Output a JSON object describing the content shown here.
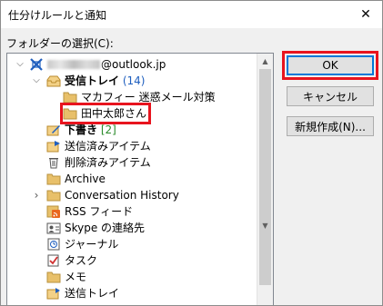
{
  "window": {
    "title": "仕分けルールと通知",
    "close_glyph": "✕"
  },
  "folder_label": "フォルダーの選択(C):",
  "tree": {
    "account": {
      "suffix": "@outlook.jp",
      "expanded": true
    },
    "items": [
      {
        "label": "受信トレイ",
        "count": "(14)",
        "bold": true,
        "expanded": true,
        "icon": "inbox-icon"
      },
      {
        "label": "マカフィー 迷惑メール対策",
        "icon": "folder-icon"
      },
      {
        "label": "田中太郎さん",
        "icon": "folder-icon",
        "highlighted": true
      },
      {
        "label": "下書き",
        "count": "[2]",
        "bold": true,
        "icon": "drafts-icon"
      },
      {
        "label": "送信済みアイテム",
        "icon": "sent-items-icon"
      },
      {
        "label": "削除済みアイテム",
        "icon": "trash-icon"
      },
      {
        "label": "Archive",
        "icon": "folder-icon"
      },
      {
        "label": "Conversation History",
        "icon": "folder-icon",
        "collapsed": true
      },
      {
        "label": "RSS フィード",
        "icon": "rss-icon"
      },
      {
        "label": "Skype の連絡先",
        "icon": "contacts-icon"
      },
      {
        "label": "ジャーナル",
        "icon": "journal-icon"
      },
      {
        "label": "タスク",
        "icon": "tasks-icon"
      },
      {
        "label": "メモ",
        "icon": "notes-icon"
      },
      {
        "label": "送信トレイ",
        "icon": "outbox-icon"
      }
    ]
  },
  "buttons": {
    "ok": "OK",
    "cancel": "キャンセル",
    "new": "新規作成(N)..."
  },
  "colors": {
    "highlight": "#e8141e",
    "count_blue": "#1f5fbf",
    "count_green": "#2a8a2a"
  }
}
